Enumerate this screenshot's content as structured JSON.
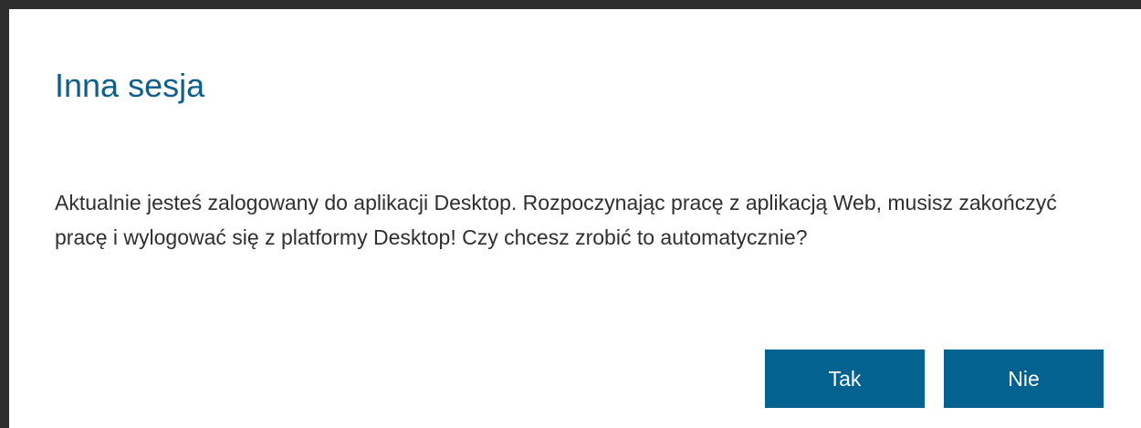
{
  "dialog": {
    "title": "Inna sesja",
    "message": "Aktualnie jesteś zalogowany do aplikacji Desktop. Rozpoczynając pracę z aplikacją Web, musisz zakończyć pracę i wylogować się z platformy Desktop! Czy chcesz zrobić to automatycznie?",
    "yes_label": "Tak",
    "no_label": "Nie"
  },
  "colors": {
    "title": "#0e5f8c",
    "button_bg": "#03628f",
    "button_text": "#ffffff",
    "frame": "#2d2d2d",
    "text": "#2f2f2f"
  }
}
